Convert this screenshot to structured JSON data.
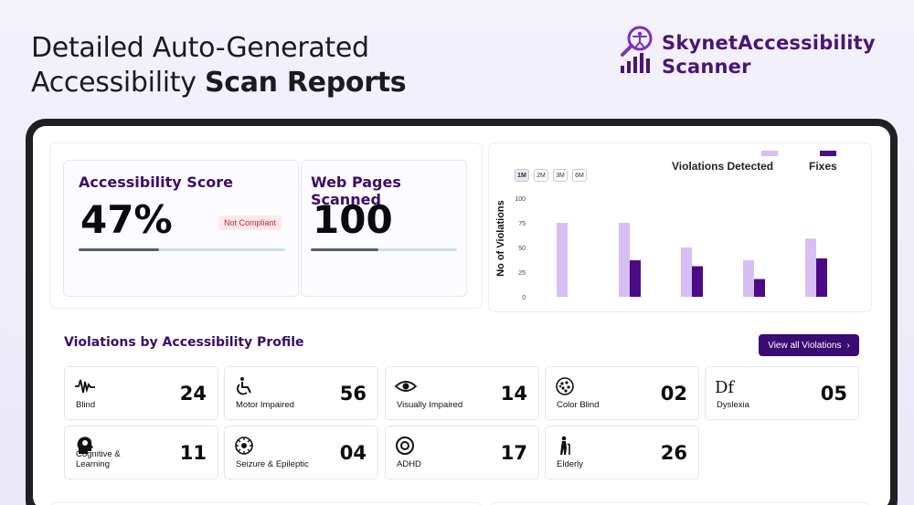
{
  "headline": {
    "line1": "Detailed Auto-Generated",
    "line2_regular": "Accessibility ",
    "line2_bold": "Scan Reports"
  },
  "logo": {
    "line1": "SkynetAccessibility",
    "line2": "Scanner",
    "color": "#4a1577"
  },
  "score_card": {
    "title": "Accessibility Score",
    "value": "47%",
    "badge": "Not Compliant",
    "progress": 0.39
  },
  "pages_card": {
    "title": "Web Pages Scanned",
    "value": "100",
    "progress": 0.46
  },
  "chart_data": {
    "type": "bar",
    "range_buttons": [
      "1M",
      "2M",
      "3M",
      "6M"
    ],
    "active_range": "1M",
    "ylabel": "No of Violations",
    "xlabel": "",
    "ylim": [
      0,
      100
    ],
    "yticks": [
      0,
      25,
      50,
      75,
      100
    ],
    "categories": [
      "",
      "",
      "",
      "",
      ""
    ],
    "series": [
      {
        "name": "Violations Detected",
        "color": "#d6bff3",
        "values": [
          75,
          75,
          50,
          37,
          59
        ]
      },
      {
        "name": "Fixes",
        "color": "#4d0a86",
        "values": [
          null,
          37,
          31,
          18,
          39
        ]
      }
    ],
    "legend": "top-right",
    "grid": false
  },
  "violations_section": {
    "title": "Violations by Accessibility Profile",
    "view_all_label": "View all Violations",
    "profiles": [
      {
        "label": "Blind",
        "count": "24",
        "icon": "blind-waveform-icon"
      },
      {
        "label": "Motor Impaired",
        "count": "56",
        "icon": "wheelchair-icon"
      },
      {
        "label": "Visually Impaired",
        "count": "14",
        "icon": "eye-icon"
      },
      {
        "label": "Color Blind",
        "count": "02",
        "icon": "color-blind-icon"
      },
      {
        "label": "Dyslexia",
        "count": "05",
        "icon": "dyslexia-icon"
      },
      {
        "label": "Cognitive & Learning",
        "count": "11",
        "icon": "brain-head-icon"
      },
      {
        "label": "Seizure & Epileptic",
        "count": "04",
        "icon": "seizure-icon"
      },
      {
        "label": "ADHD",
        "count": "17",
        "icon": "target-icon"
      },
      {
        "label": "Elderly",
        "count": "26",
        "icon": "elderly-icon"
      }
    ]
  }
}
